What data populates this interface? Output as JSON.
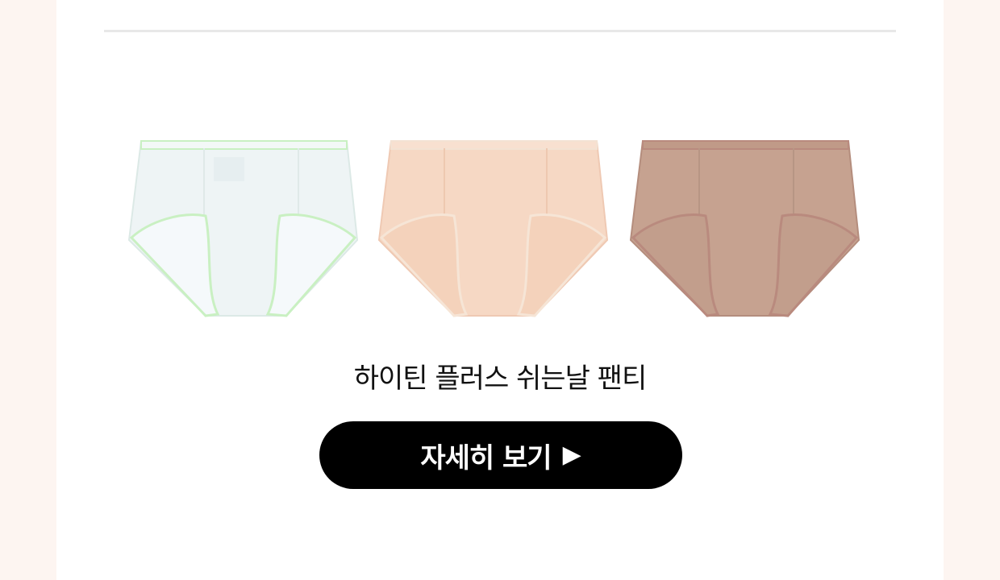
{
  "products": [
    {
      "name": "white-panty",
      "color": "#eef4f5",
      "trim": "#c9f0c2"
    },
    {
      "name": "beige-panty",
      "color": "#f6d8c4",
      "trim": "#f3e2d3"
    },
    {
      "name": "brown-panty",
      "color": "#c6a290",
      "trim": "#b98a7e"
    }
  ],
  "product": {
    "title": "하이틴 플러스 쉬는날 팬티"
  },
  "cta": {
    "label": "자세히 보기",
    "arrow": "▶"
  },
  "colors": {
    "background": "#fdf5f1",
    "panel": "#ffffff",
    "button": "#000000",
    "button_text": "#ffffff"
  }
}
